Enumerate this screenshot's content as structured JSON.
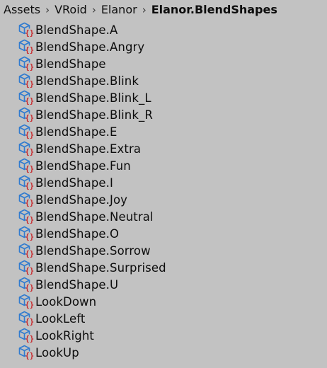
{
  "breadcrumb": [
    "Assets",
    "VRoid",
    "Elanor",
    "Elanor.BlendShapes"
  ],
  "items": [
    "BlendShape.A",
    "BlendShape.Angry",
    "BlendShape",
    "BlendShape.Blink",
    "BlendShape.Blink_L",
    "BlendShape.Blink_R",
    "BlendShape.E",
    "BlendShape.Extra",
    "BlendShape.Fun",
    "BlendShape.I",
    "BlendShape.Joy",
    "BlendShape.Neutral",
    "BlendShape.O",
    "BlendShape.Sorrow",
    "BlendShape.Surprised",
    "BlendShape.U",
    "LookDown",
    "LookLeft",
    "LookRight",
    "LookUp"
  ],
  "icon": "scriptable-object-icon",
  "colors": {
    "background": "#c2c2c2",
    "icon_blue": "#2f7bd0",
    "icon_red": "#c8282c"
  }
}
